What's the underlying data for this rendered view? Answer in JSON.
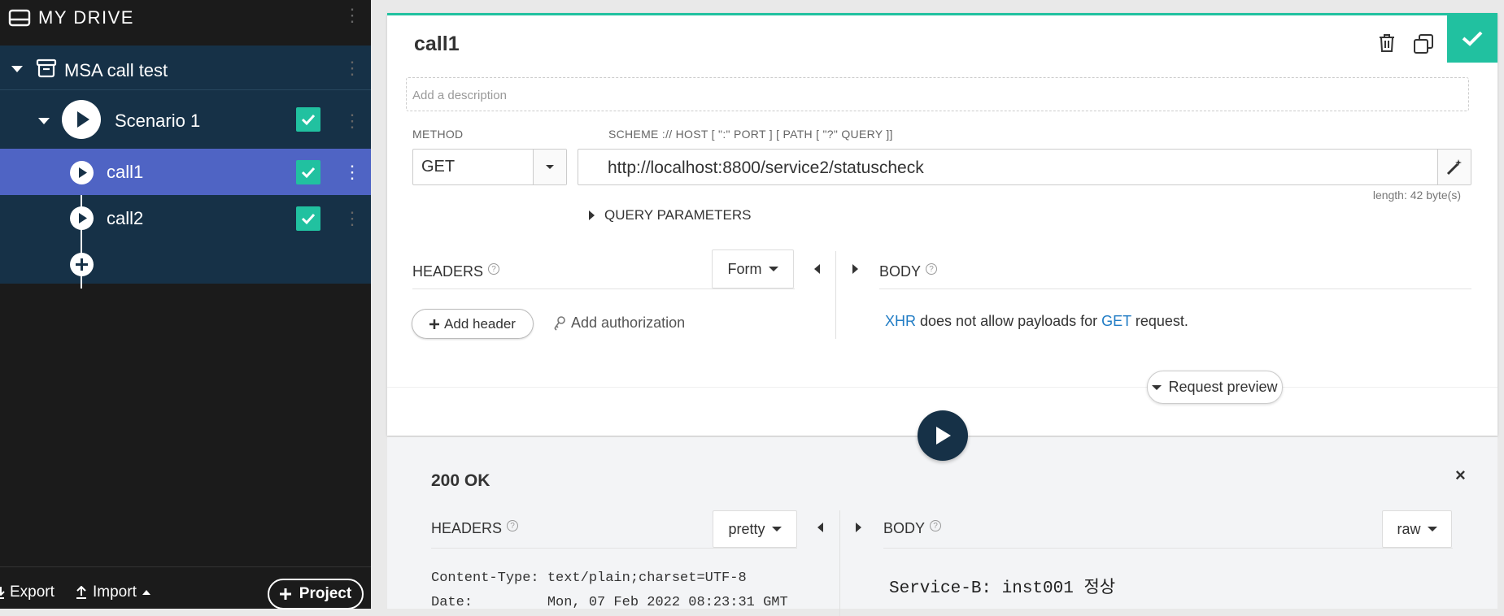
{
  "sidebar": {
    "title": "MY DRIVE",
    "project": {
      "label": "MSA call test"
    },
    "scenario": {
      "label": "Scenario 1",
      "checked": true
    },
    "calls": [
      {
        "label": "call1",
        "selected": true,
        "checked": true
      },
      {
        "label": "call2",
        "selected": false,
        "checked": true
      }
    ],
    "footer": {
      "export_label": "Export",
      "import_label": "Import",
      "project_label": "Project"
    }
  },
  "request": {
    "title": "call1",
    "description_placeholder": "Add a description",
    "method_label": "METHOD",
    "method_value": "GET",
    "url_label": "SCHEME :// HOST [ \":\" PORT ] [ PATH [ \"?\" QUERY ]]",
    "url_value": "http://localhost:8800/service2/statuscheck",
    "length_text": "length: 42 byte(s)",
    "query_params_label": "QUERY PARAMETERS",
    "headers_label": "HEADERS",
    "headers_mode": "Form",
    "body_label": "BODY",
    "add_header_label": "Add header",
    "add_auth_label": "Add authorization",
    "xhr_msg": {
      "xhr": "XHR",
      "middle": " does not allow payloads for ",
      "get": "GET",
      "end": " request."
    },
    "request_preview_label": "Request preview"
  },
  "response": {
    "status": "200 OK",
    "headers_label": "HEADERS",
    "headers_mode": "pretty",
    "body_label": "BODY",
    "body_mode": "raw",
    "header_lines": [
      "Content-Type: text/plain;charset=UTF-8",
      "Date:         Mon, 07 Feb 2022 08:23:31 GMT"
    ],
    "body_text": "Service-B: inst001 정상"
  },
  "colors": {
    "accent": "#21c1a0",
    "sidebar_bg": "#1b1b1b",
    "tree_bg": "#163147",
    "selected_row": "#4f64c4",
    "link": "#1f7bc4"
  }
}
